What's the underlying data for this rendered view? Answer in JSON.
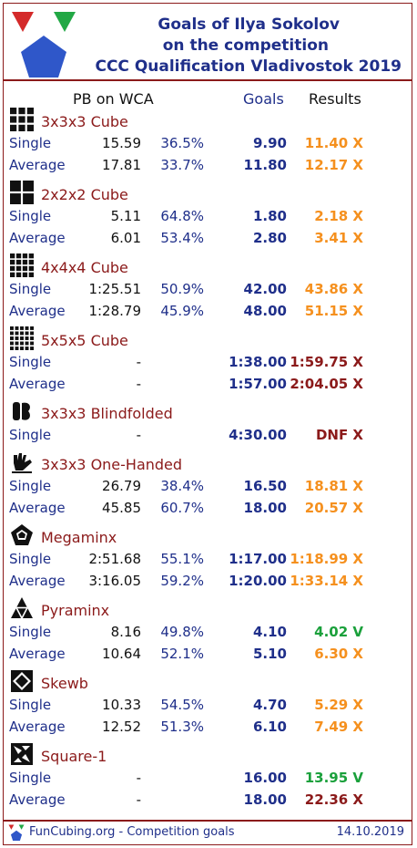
{
  "header": {
    "title_line1": "Goals of Ilya Sokolov",
    "title_line2": "on the competition",
    "title_line3": "CCC Qualification Vladivostok 2019"
  },
  "columns": {
    "pb": "PB on WCA",
    "goals": "Goals",
    "results": "Results"
  },
  "events": [
    {
      "name": "3x3x3 Cube",
      "icon": "cube-3x3-icon",
      "rows": [
        {
          "label": "Single",
          "pb": "15.59",
          "pct": "36.5%",
          "goal": "9.90",
          "result": "11.40 X",
          "status": "orange"
        },
        {
          "label": "Average",
          "pb": "17.81",
          "pct": "33.7%",
          "goal": "11.80",
          "result": "12.17 X",
          "status": "orange"
        }
      ]
    },
    {
      "name": "2x2x2 Cube",
      "icon": "cube-2x2-icon",
      "rows": [
        {
          "label": "Single",
          "pb": "5.11",
          "pct": "64.8%",
          "goal": "1.80",
          "result": "2.18 X",
          "status": "orange"
        },
        {
          "label": "Average",
          "pb": "6.01",
          "pct": "53.4%",
          "goal": "2.80",
          "result": "3.41 X",
          "status": "orange"
        }
      ]
    },
    {
      "name": "4x4x4 Cube",
      "icon": "cube-4x4-icon",
      "rows": [
        {
          "label": "Single",
          "pb": "1:25.51",
          "pct": "50.9%",
          "goal": "42.00",
          "result": "43.86 X",
          "status": "orange"
        },
        {
          "label": "Average",
          "pb": "1:28.79",
          "pct": "45.9%",
          "goal": "48.00",
          "result": "51.15 X",
          "status": "orange"
        }
      ]
    },
    {
      "name": "5x5x5 Cube",
      "icon": "cube-5x5-icon",
      "rows": [
        {
          "label": "Single",
          "pb": "-",
          "pct": "",
          "goal": "1:38.00",
          "result": "1:59.75 X",
          "status": "red"
        },
        {
          "label": "Average",
          "pb": "-",
          "pct": "",
          "goal": "1:57.00",
          "result": "2:04.05 X",
          "status": "red"
        }
      ]
    },
    {
      "name": "3x3x3 Blindfolded",
      "icon": "blindfolded-icon",
      "rows": [
        {
          "label": "Single",
          "pb": "-",
          "pct": "",
          "goal": "4:30.00",
          "result": "DNF X",
          "status": "red"
        }
      ]
    },
    {
      "name": "3x3x3 One-Handed",
      "icon": "one-handed-icon",
      "rows": [
        {
          "label": "Single",
          "pb": "26.79",
          "pct": "38.4%",
          "goal": "16.50",
          "result": "18.81 X",
          "status": "orange"
        },
        {
          "label": "Average",
          "pb": "45.85",
          "pct": "60.7%",
          "goal": "18.00",
          "result": "20.57 X",
          "status": "orange"
        }
      ]
    },
    {
      "name": "Megaminx",
      "icon": "megaminx-icon",
      "rows": [
        {
          "label": "Single",
          "pb": "2:51.68",
          "pct": "55.1%",
          "goal": "1:17.00",
          "result": "1:18.99 X",
          "status": "orange"
        },
        {
          "label": "Average",
          "pb": "3:16.05",
          "pct": "59.2%",
          "goal": "1:20.00",
          "result": "1:33.14 X",
          "status": "orange"
        }
      ]
    },
    {
      "name": "Pyraminx",
      "icon": "pyraminx-icon",
      "rows": [
        {
          "label": "Single",
          "pb": "8.16",
          "pct": "49.8%",
          "goal": "4.10",
          "result": "4.02 V",
          "status": "green"
        },
        {
          "label": "Average",
          "pb": "10.64",
          "pct": "52.1%",
          "goal": "5.10",
          "result": "6.30 X",
          "status": "orange"
        }
      ]
    },
    {
      "name": "Skewb",
      "icon": "skewb-icon",
      "rows": [
        {
          "label": "Single",
          "pb": "10.33",
          "pct": "54.5%",
          "goal": "4.70",
          "result": "5.29 X",
          "status": "orange"
        },
        {
          "label": "Average",
          "pb": "12.52",
          "pct": "51.3%",
          "goal": "6.10",
          "result": "7.49 X",
          "status": "orange"
        }
      ]
    },
    {
      "name": "Square-1",
      "icon": "square1-icon",
      "rows": [
        {
          "label": "Single",
          "pb": "-",
          "pct": "",
          "goal": "16.00",
          "result": "13.95 V",
          "status": "green"
        },
        {
          "label": "Average",
          "pb": "-",
          "pct": "",
          "goal": "18.00",
          "result": "22.36 X",
          "status": "red"
        }
      ]
    }
  ],
  "footer": {
    "site": "FunCubing.org - Competition goals",
    "date": "14.10.2019"
  },
  "colors": {
    "brand_red": "#8b1a1a",
    "navy": "#1f2f8a",
    "orange": "#f5901e",
    "green": "#1aa03b"
  }
}
